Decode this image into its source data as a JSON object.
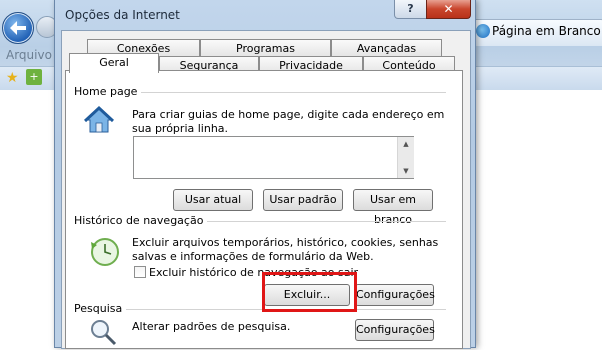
{
  "browser": {
    "menu_arquivo": "Arquivo",
    "tab_label": "Página em Branco"
  },
  "dialog": {
    "title": "Opções da Internet",
    "help_label": "?",
    "close_label": "✕",
    "tabs_row1": [
      "Conexões",
      "Programas",
      "Avançadas"
    ],
    "tabs_row2": [
      "Geral",
      "Segurança",
      "Privacidade",
      "Conteúdo"
    ],
    "active_tab": "Geral",
    "home": {
      "title": "Home page",
      "description": "Para criar guias de home page, digite cada endereço em sua própria linha.",
      "textarea_value": "",
      "btn_current": "Usar atual",
      "btn_default": "Usar padrão",
      "btn_blank": "Usar em branco"
    },
    "history": {
      "title": "Histórico de navegação",
      "description": "Excluir arquivos temporários, histórico, cookies, senhas salvas e informações de formulário da Web.",
      "checkbox_label": "Excluir histórico de navegação ao sair",
      "checkbox_checked": false,
      "btn_delete": "Excluir...",
      "btn_settings": "Configurações"
    },
    "search": {
      "title": "Pesquisa",
      "description": "Alterar padrões de pesquisa.",
      "btn_settings": "Configurações"
    }
  },
  "colors": {
    "highlight": "#e01616",
    "dialog_frame": "#b3cae3",
    "close_button": "#c9452c"
  }
}
